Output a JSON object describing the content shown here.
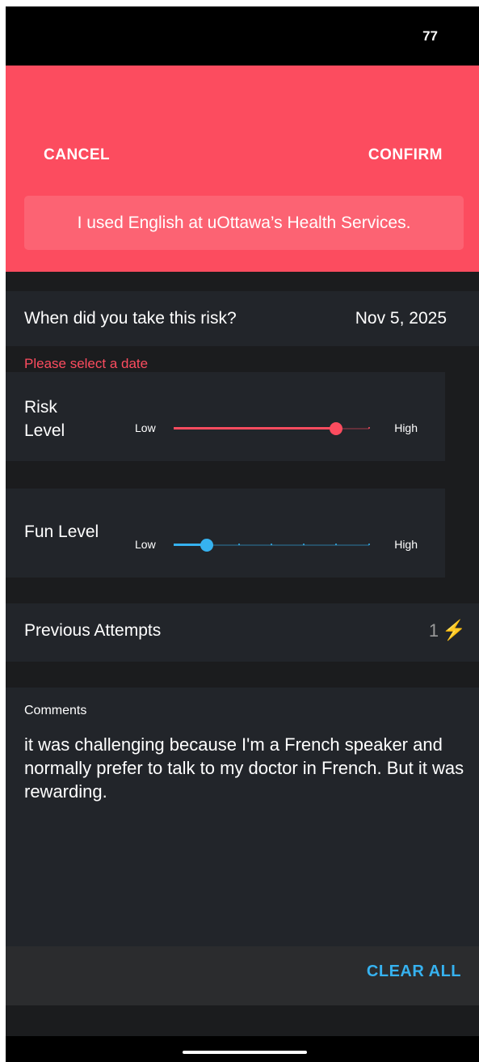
{
  "status": {
    "value": "77"
  },
  "header": {
    "cancel_label": "CANCEL",
    "confirm_label": "CONFIRM",
    "title": "I used English at uOttawa’s Health Services."
  },
  "date": {
    "label": "When did you take this risk?",
    "value": "Nov 5, 2025",
    "error": "Please select a date"
  },
  "risk": {
    "label_line1": "Risk",
    "label_line2": "Level",
    "low": "Low",
    "high": "High",
    "level_fraction": 0.83,
    "color": "#fc4c5f"
  },
  "fun": {
    "label": "Fun Level",
    "low": "Low",
    "high": "High",
    "level_fraction": 0.17,
    "color": "#36b2f0"
  },
  "attempts": {
    "label": "Previous Attempts",
    "count": "1",
    "icon": "lightning-icon"
  },
  "comments": {
    "label": "Comments",
    "text": "it was challenging because I'm a French speaker and normally prefer to talk to my doctor in French. But it was rewarding."
  },
  "footer": {
    "clear_label": "CLEAR ALL"
  },
  "colors": {
    "accent": "#fc4c5f",
    "link": "#36b2f0",
    "bolt": "#f2c521",
    "background": "#1b1c1e",
    "card": "#22252a"
  }
}
